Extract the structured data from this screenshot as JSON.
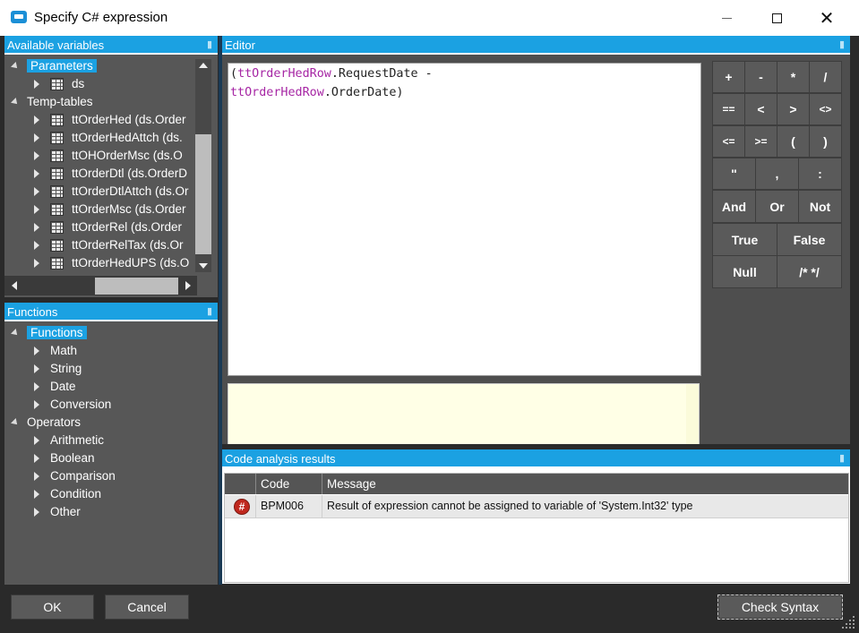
{
  "window": {
    "title": "Specify C# expression"
  },
  "variables_panel": {
    "header": "Available variables",
    "parameters_label": "Parameters",
    "parameters": [
      "ds"
    ],
    "temp_tables_label": "Temp-tables",
    "temp_tables": [
      "ttOrderHed (ds.Order",
      "ttOrderHedAttch (ds.",
      "ttOHOrderMsc (ds.O",
      "ttOrderDtl (ds.OrderD",
      "ttOrderDtlAttch (ds.Or",
      "ttOrderMsc (ds.Order",
      "ttOrderRel (ds.Order",
      "ttOrderRelTax (ds.Or",
      "ttOrderHedUPS (ds.O"
    ]
  },
  "functions_panel": {
    "header": "Functions",
    "functions_label": "Functions",
    "functions": [
      "Math",
      "String",
      "Date",
      "Conversion"
    ],
    "operators_label": "Operators",
    "operators": [
      "Arithmetic",
      "Boolean",
      "Comparison",
      "Condition",
      "Other"
    ]
  },
  "editor": {
    "header": "Editor",
    "line1_open": "(",
    "line1_ident": "ttOrderHedRow",
    "line1_rest": ".RequestDate -",
    "line2_ident": "ttOrderHedRow",
    "line2_rest": ".OrderDate)"
  },
  "keypad": {
    "row1": [
      "+",
      "-",
      "*",
      "/"
    ],
    "row2": [
      "==",
      "<",
      ">",
      "<>"
    ],
    "row3": [
      "<=",
      ">=",
      "(",
      ")"
    ],
    "row4": [
      "\"",
      ",",
      ":"
    ],
    "row5": [
      "And",
      "Or",
      "Not"
    ],
    "row6": [
      "True",
      "False"
    ],
    "row7": [
      "Null",
      "/* */"
    ]
  },
  "results": {
    "header": "Code analysis results",
    "columns": [
      "Code",
      "Message"
    ],
    "rows": [
      {
        "icon": "#",
        "code": "BPM006",
        "message": "Result of expression cannot be assigned to variable of 'System.Int32' type"
      }
    ]
  },
  "buttons": {
    "ok": "OK",
    "cancel": "Cancel",
    "check_syntax": "Check Syntax"
  },
  "colors": {
    "accent": "#1ba1e2",
    "panel": "#575757",
    "error": "#c0281e"
  }
}
